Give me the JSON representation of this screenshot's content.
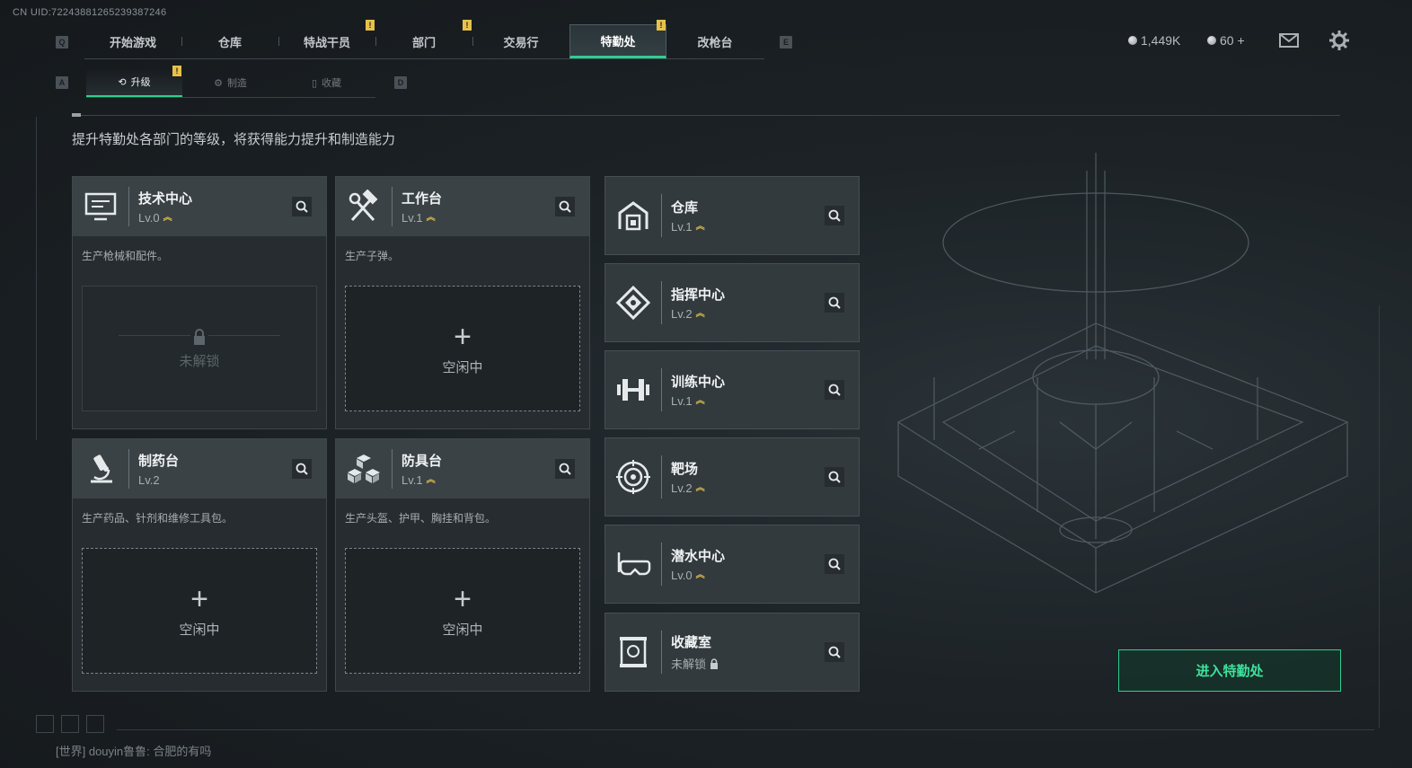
{
  "uid": "CN UID:7224388126523938​7246",
  "top_nav": {
    "key_left": "Q",
    "key_right": "E",
    "tabs": [
      {
        "label": "开始游戏",
        "flag": ""
      },
      {
        "label": "仓库",
        "flag": ""
      },
      {
        "label": "特战干员",
        "flag": "!"
      },
      {
        "label": "部门",
        "flag": "!"
      },
      {
        "label": "交易行",
        "flag": ""
      },
      {
        "label": "特勤处",
        "flag": "!",
        "active": true
      },
      {
        "label": "改枪台",
        "flag": ""
      }
    ]
  },
  "currency": {
    "coins": "1,449K",
    "tickets": "60 +"
  },
  "sub_nav": {
    "key_left": "A",
    "key_right": "D",
    "tabs": [
      {
        "label": "升级",
        "flag": "!",
        "active": true
      },
      {
        "label": "制造",
        "flag": ""
      },
      {
        "label": "收藏",
        "flag": ""
      }
    ]
  },
  "description": "提升特勤处各部门的等级，将获得能力提升和制造能力",
  "cards": [
    {
      "title": "技术中心",
      "level": "Lv.0",
      "desc": "生产枪械和配件。",
      "slot_status": "未解锁",
      "locked": true
    },
    {
      "title": "工作台",
      "level": "Lv.1",
      "desc": "生产子弹。",
      "slot_status": "空闲中",
      "locked": false
    },
    {
      "title": "制药台",
      "level": "Lv.2",
      "desc": "生产药品、针剂和维修工具包。",
      "slot_status": "空闲中",
      "locked": false
    },
    {
      "title": "防具台",
      "level": "Lv.1",
      "desc": "生产头盔、护甲、胸挂和背包。",
      "slot_status": "空闲中",
      "locked": false
    }
  ],
  "side_list": [
    {
      "title": "仓库",
      "level": "Lv.1"
    },
    {
      "title": "指挥中心",
      "level": "Lv.2"
    },
    {
      "title": "训练中心",
      "level": "Lv.1"
    },
    {
      "title": "靶场",
      "level": "Lv.2"
    },
    {
      "title": "潜水中心",
      "level": "Lv.0"
    },
    {
      "title": "收藏室",
      "level": "未解锁"
    }
  ],
  "enter_button": "进入特勤处",
  "chat": "[世界] douyin鲁鲁: 合肥的有吗",
  "colors": {
    "accent": "#2fcf8f",
    "upgrade": "#e3c04a",
    "card_header": "#3a4246"
  }
}
